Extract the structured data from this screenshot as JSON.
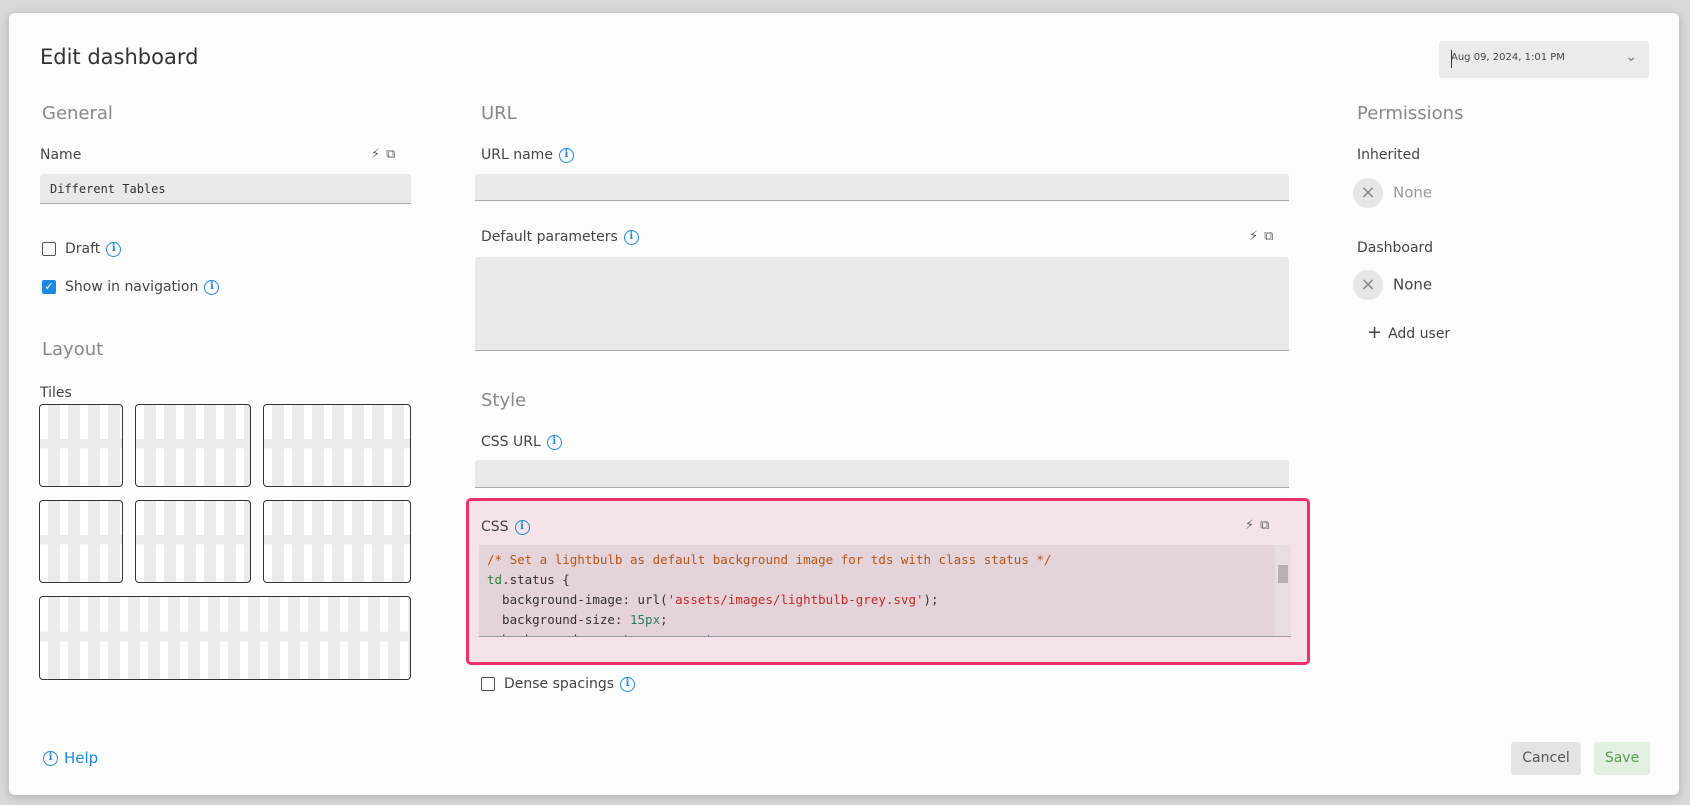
{
  "header": {
    "title": "Edit dashboard",
    "date_select": "Aug 09, 2024, 1:01 PM"
  },
  "general": {
    "heading": "General",
    "name_label": "Name",
    "name_value": "Different Tables",
    "draft_label": "Draft",
    "draft_checked": false,
    "show_nav_label": "Show in navigation",
    "show_nav_checked": true
  },
  "layout": {
    "heading": "Layout",
    "tiles_label": "Tiles"
  },
  "url": {
    "heading": "URL",
    "url_name_label": "URL name",
    "url_name_value": "",
    "default_params_label": "Default parameters",
    "default_params_value": ""
  },
  "style": {
    "heading": "Style",
    "css_url_label": "CSS URL",
    "css_url_value": "",
    "css_label": "CSS",
    "css_lines": [
      "/* Set a lightbulb as default background image for tds with class status */",
      "td.status {",
      "  background-image: url('assets/images/lightbulb-grey.svg');",
      "  background-size: 15px;",
      "  background-repeat: no-repeat;"
    ],
    "dense_label": "Dense spacings",
    "dense_checked": false,
    "highlight_color": "#f0306a"
  },
  "permissions": {
    "heading": "Permissions",
    "inherited_label": "Inherited",
    "inherited_value": "None",
    "dashboard_label": "Dashboard",
    "dashboard_value": "None",
    "add_user": "Add user"
  },
  "footer": {
    "help": "Help",
    "cancel": "Cancel",
    "save": "Save"
  }
}
